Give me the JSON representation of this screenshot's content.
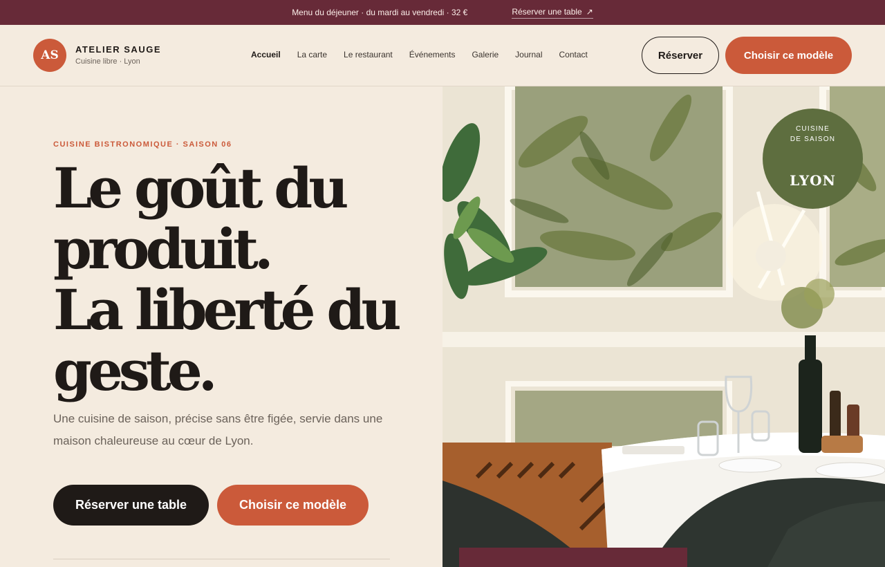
{
  "topbar": {
    "announcement": "Menu du déjeuner · du mardi au vendredi · 32 €",
    "link_label": "Réserver une table",
    "link_icon": "arrow-up-right-icon"
  },
  "header": {
    "logo_initials": "AS",
    "brand_name": "ATELIER SAUGE",
    "brand_sub": "Cuisine libre · Lyon",
    "nav": [
      "Accueil",
      "La carte",
      "Le restaurant",
      "Événements",
      "Galerie",
      "Journal",
      "Contact"
    ],
    "active_nav": "Accueil",
    "reserve_label": "Réserver",
    "choose_label": "Choisir ce modèle"
  },
  "hero": {
    "eyebrow": "CUISINE BISTRONOMIQUE · SAISON 06",
    "headline": [
      "Le goût du",
      "produit.",
      "La liberté du",
      "geste."
    ],
    "lede": "Une cuisine de saison, précise sans être figée, servie dans une maison chaleureuse au cœur de Lyon.",
    "cta_primary": "Réserver une table",
    "cta_secondary": "Choisir ce modèle"
  },
  "seal": {
    "line1": "CUISINE",
    "line2": "DE SAISON",
    "city": "LYON"
  },
  "colors": {
    "accent": "#cb5a3a",
    "burgundy": "#672a38",
    "olive": "#5e6e3f",
    "cream": "#f4ebdf",
    "ink": "#1f1a17"
  }
}
